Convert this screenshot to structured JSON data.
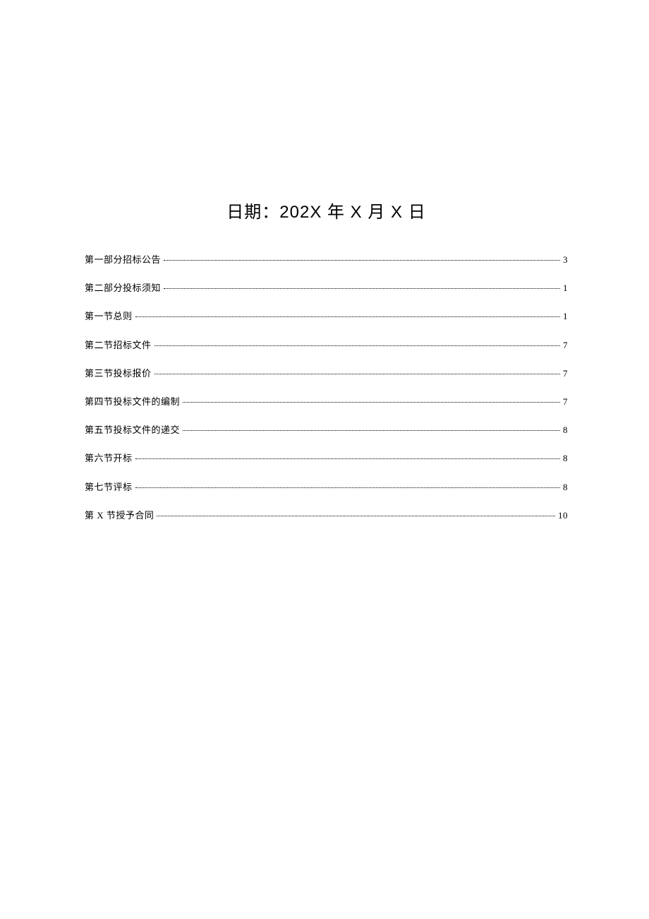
{
  "title": "日期：202X 年 X 月 X 日",
  "toc": [
    {
      "label": "第一部分招标公告",
      "page": "3"
    },
    {
      "label": "第二部分投标须知",
      "page": "1"
    },
    {
      "label": "第一节总则",
      "page": "1"
    },
    {
      "label": "第二节招标文件",
      "page": "7"
    },
    {
      "label": "第三节投标报价",
      "page": "7"
    },
    {
      "label": "第四节投标文件的编制",
      "page": "7"
    },
    {
      "label": "第五节投标文件的递交",
      "page": "8"
    },
    {
      "label": "第六节开标",
      "page": "8"
    },
    {
      "label": "第七节评标",
      "page": "8"
    },
    {
      "label": "第 X 节授予合同",
      "page": "10"
    }
  ]
}
